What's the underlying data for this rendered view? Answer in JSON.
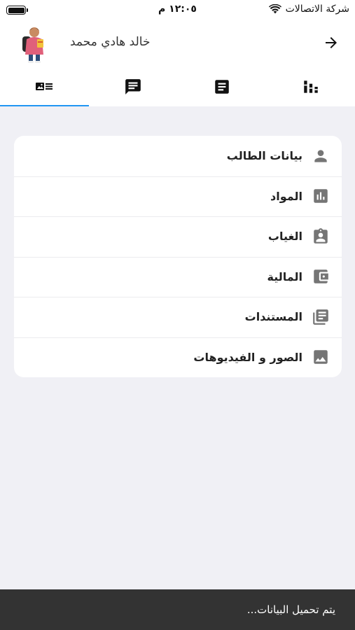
{
  "status_bar": {
    "carrier": "شركة الاتصالات",
    "time": "١٢:٠٥ م",
    "battery_level": 1.0
  },
  "header": {
    "student_name": "خالد هادي محمد",
    "back_icon": "arrow-right-icon",
    "avatar": "student-avatar"
  },
  "tabs": [
    {
      "icon": "student-card-icon",
      "active": true
    },
    {
      "icon": "chat-icon",
      "active": false
    },
    {
      "icon": "document-icon",
      "active": false
    },
    {
      "icon": "bar-chart-icon",
      "active": false
    }
  ],
  "menu": {
    "items": [
      {
        "label": "بيانات الطالب",
        "icon": "person-icon"
      },
      {
        "label": "المواد",
        "icon": "assessment-icon"
      },
      {
        "label": "الغياب",
        "icon": "assignment-ind-icon"
      },
      {
        "label": "المالية",
        "icon": "wallet-icon"
      },
      {
        "label": "المستندات",
        "icon": "library-books-icon"
      },
      {
        "label": "الصور و الفيديوهات",
        "icon": "image-icon"
      }
    ]
  },
  "snackbar": {
    "text": "يتم تحميل البيانات..."
  },
  "colors": {
    "accent": "#2196f3",
    "icon_gray": "#757575",
    "background": "#f0f0f5",
    "snackbar": "#333333"
  }
}
